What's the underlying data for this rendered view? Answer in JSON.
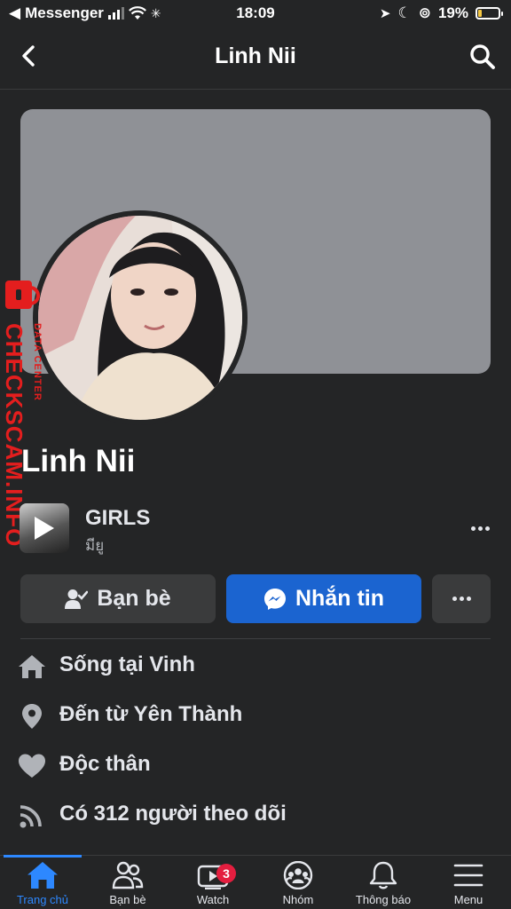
{
  "status_bar": {
    "carrier": "Messenger",
    "time": "18:09",
    "battery": "19%",
    "battery_level": 0.19
  },
  "header": {
    "title": "Linh Nii"
  },
  "watermark": {
    "brand": "CHECKSCAM.INFO",
    "sub": "DATA CENTER"
  },
  "profile": {
    "name": "Linh Nii"
  },
  "music": {
    "song": "GIRLS",
    "artist": "มียู"
  },
  "actions": {
    "friends_label": "Bạn bè",
    "message_label": "Nhắn tin"
  },
  "details": [
    {
      "icon": "home-icon",
      "text": "Sống tại Vinh"
    },
    {
      "icon": "location-pin-icon",
      "text": "Đến từ Yên Thành"
    },
    {
      "icon": "heart-icon",
      "text": "Độc thân"
    },
    {
      "icon": "rss-icon",
      "text": "Có 312 người theo dõi"
    }
  ],
  "tabs": [
    {
      "label": "Trang chủ",
      "icon": "home-icon",
      "active": true
    },
    {
      "label": "Bạn bè",
      "icon": "friends-icon",
      "active": false
    },
    {
      "label": "Watch",
      "icon": "watch-icon",
      "active": false,
      "badge": "3"
    },
    {
      "label": "Nhóm",
      "icon": "groups-icon",
      "active": false
    },
    {
      "label": "Thông báo",
      "icon": "bell-icon",
      "active": false
    },
    {
      "label": "Menu",
      "icon": "menu-icon",
      "active": false
    }
  ],
  "colors": {
    "background": "#242526",
    "accent": "#2d88ff",
    "message_button": "#1b64d0",
    "watermark": "#e41e1e",
    "badge": "#e41e3f"
  }
}
